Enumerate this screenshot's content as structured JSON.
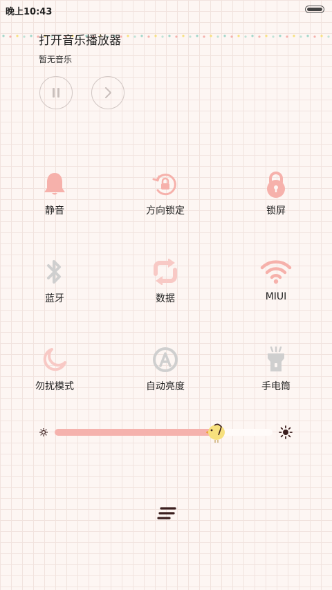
{
  "status": {
    "time": "晚上10:43"
  },
  "music": {
    "title": "打开音乐播放器",
    "subtitle": "暂无音乐"
  },
  "toggles": [
    {
      "label": "静音",
      "icon": "bell-icon"
    },
    {
      "label": "方向锁定",
      "icon": "rotation-lock-icon"
    },
    {
      "label": "锁屏",
      "icon": "lock-icon"
    },
    {
      "label": "蓝牙",
      "icon": "bluetooth-icon"
    },
    {
      "label": "数据",
      "icon": "data-arrows-icon"
    },
    {
      "label": "MIUI",
      "icon": "wifi-icon"
    },
    {
      "label": "勿扰模式",
      "icon": "moon-icon"
    },
    {
      "label": "自动亮度",
      "icon": "auto-brightness-icon"
    },
    {
      "label": "手电筒",
      "icon": "flashlight-icon"
    }
  ],
  "brightness": {
    "level": 0.74
  },
  "colors": {
    "accent": "#f5aba6",
    "inactive": "#cfcfcf",
    "dark": "#3b1f1f"
  }
}
